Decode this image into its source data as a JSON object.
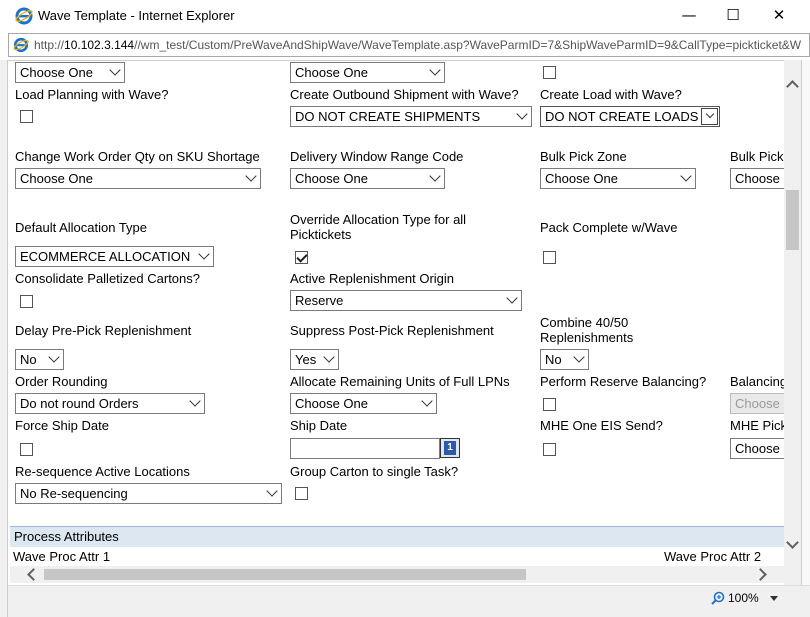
{
  "window": {
    "title": "Wave Template - Internet Explorer",
    "url_prefix": "http://",
    "url_host": "10.102.3.144",
    "url_path": "//wm_test/Custom/PreWaveAndShipWave/WaveTemplate.asp?WaveParmID=7&ShipWaveParmID=9&CallType=pickticket&W",
    "minimize_icon": "minimize-icon",
    "maximize_icon": "maximize-icon",
    "close_icon": "close-icon"
  },
  "row0": {
    "sel_a": "Choose One",
    "sel_b": "Choose One"
  },
  "row1": {
    "load_planning_label": "Load Planning with Wave?",
    "create_shipment_label": "Create Outbound Shipment with Wave?",
    "create_shipment_value": "DO NOT CREATE SHIPMENTS",
    "create_load_label": "Create Load with Wave?",
    "create_load_value": "DO NOT CREATE LOADS"
  },
  "row2": {
    "change_wo_label": "Change Work Order Qty on SKU Shortage",
    "change_wo_value": "Choose One",
    "delivery_window_label": "Delivery Window Range Code",
    "delivery_window_value": "Choose One",
    "bulk_pick_zone_label": "Bulk Pick Zone",
    "bulk_pick_zone_value": "Choose One",
    "bulk_pick_label": "Bulk Pick",
    "bulk_pick_value": "Choose"
  },
  "row3": {
    "default_alloc_label": "Default Allocation Type",
    "default_alloc_value": "ECOMMERCE ALLOCATION",
    "override_alloc_label_1": "Override Allocation Type for all",
    "override_alloc_label_2": "Picktickets",
    "pack_complete_label": "Pack Complete w/Wave"
  },
  "row4": {
    "consolidate_label": "Consolidate Palletized Cartons?",
    "active_repl_label": "Active Replenishment Origin",
    "active_repl_value": "Reserve"
  },
  "row5": {
    "delay_prepick_label": "Delay Pre-Pick Replenishment",
    "delay_prepick_value": "No",
    "suppress_postpick_label": "Suppress Post-Pick Replenishment",
    "suppress_postpick_value": "Yes",
    "combine_label_1": "Combine 40/50",
    "combine_label_2": "Replenishments",
    "combine_value": "No"
  },
  "row6": {
    "order_rounding_label": "Order Rounding",
    "order_rounding_value": "Do not round Orders",
    "allocate_remaining_label": "Allocate Remaining Units of Full LPNs",
    "allocate_remaining_value": "Choose One",
    "reserve_balancing_label": "Perform Reserve Balancing?",
    "balancing_label": "Balancing",
    "balancing_value": "Choose"
  },
  "row7": {
    "force_ship_label": "Force Ship Date",
    "ship_date_label": "Ship Date",
    "ship_date_value": "",
    "calendar_glyph": "1",
    "mhe_eis_label": "MHE One EIS Send?",
    "mhe_pick_label": "MHE Pick",
    "mhe_pick_value": "Choose"
  },
  "row8": {
    "resequence_label": "Re-sequence Active Locations",
    "resequence_value": "No Re-sequencing",
    "group_carton_label": "Group Carton to single Task?"
  },
  "process": {
    "section_title": "Process Attributes",
    "attr1_label": "Wave Proc Attr 1",
    "attr2_label": "Wave Proc Attr 2"
  },
  "status": {
    "zoom": "100%"
  },
  "colors": {
    "section_bg": "#dde7f2",
    "ie_blue": "#1e73c9",
    "ie_ring": "#f2b01e"
  }
}
